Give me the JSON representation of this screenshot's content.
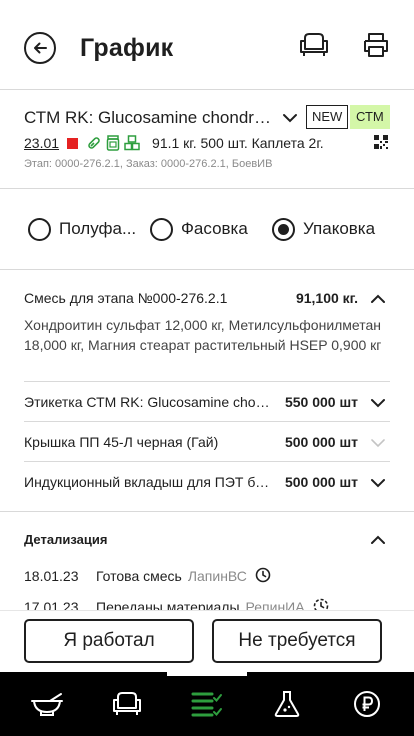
{
  "header": {
    "title": "График",
    "icons": [
      "back-arrow-icon",
      "armchair-icon",
      "printer-icon"
    ]
  },
  "product": {
    "name": "СТМ RK: Glucosamine chondroitin MSM",
    "badge_new": "NEW",
    "badge_ctm": "СТМ",
    "date": "23.01",
    "meta": "91.1 кг. 500 шт. Каплета 2г.",
    "info": "Этап: 0000-276.2.1, Заказ: 0000-276.2.1, БоевИВ",
    "colors": {
      "red_marker": "#e52222",
      "green_icons": "#2e9e3e",
      "badge_ctm_bg": "#d4f7a8"
    }
  },
  "stages": {
    "options": [
      {
        "label": "Полуфа...",
        "selected": false
      },
      {
        "label": "Фасовка",
        "selected": false
      },
      {
        "label": "Упаковка",
        "selected": true
      }
    ]
  },
  "mix": {
    "title": "Смесь для этапа №000-276.2.1",
    "amount": "91,100 кг.",
    "description": "Хондроитин сульфат 12,000 кг, Метилсульфонилметан 18,000 кг, Магния стеарат растительный HSEP 0,900 кг"
  },
  "materials": [
    {
      "name": "Этикетка СТМ RK: Glucosamine chondroitin",
      "qty": "550 000 шт",
      "chevron": "dark"
    },
    {
      "name": "Крышка ПП 45-Л черная (Гай)",
      "qty": "500 000 шт",
      "chevron": "light"
    },
    {
      "name": "Индукционный вкладыш для ПЭТ банок",
      "qty": "500 000 шт",
      "chevron": "dark"
    }
  ],
  "details": {
    "title": "Детализация",
    "rows": [
      {
        "date": "18.01.23",
        "event": "Готова смесь",
        "user": "ЛапинВС"
      },
      {
        "date": "17.01.23",
        "event": "Переданы материалы",
        "user": "РепинИА"
      }
    ]
  },
  "actions": {
    "worked": "Я работал",
    "not_required": "Не требуется"
  },
  "tabbar": {
    "tabs": [
      "bowl-icon",
      "armchair-icon",
      "checklist-icon",
      "flask-icon",
      "ruble-icon"
    ],
    "active_index": 2,
    "active_color": "#2e9e3e"
  }
}
